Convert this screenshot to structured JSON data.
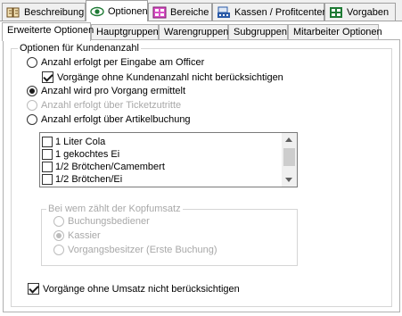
{
  "top_tabs": [
    {
      "label": "Beschreibung",
      "icon": "book-icon"
    },
    {
      "label": "Optionen",
      "icon": "eye-icon"
    },
    {
      "label": "Bereiche",
      "icon": "areas-icon"
    },
    {
      "label": "Kassen / Profitcenter",
      "icon": "register-icon"
    },
    {
      "label": "Vorgaben",
      "icon": "settings-grid-icon"
    }
  ],
  "sub_tabs": [
    {
      "label": "Erweiterte Optionen"
    },
    {
      "label": "Hauptgruppen"
    },
    {
      "label": "Warengruppen"
    },
    {
      "label": "Subgruppen"
    },
    {
      "label": "Mitarbeiter Optionen"
    }
  ],
  "group": {
    "title": "Optionen für Kundenanzahl",
    "opt_officer": "Anzahl erfolgt per Eingabe am Officer",
    "chk_ignore_no_customers": "Vorgänge ohne Kundenanzahl nicht berücksichtigen",
    "opt_per_vorgang": "Anzahl wird pro Vorgang ermittelt",
    "opt_ticket": "Anzahl erfolgt über Ticketzutritte",
    "opt_article": "Anzahl erfolgt über Artikelbuchung"
  },
  "articles": [
    "1 Liter Cola",
    "1 gekochtes Ei",
    "1/2 Brötchen/Camembert",
    "1/2 Brötchen/Ei"
  ],
  "kopfumsatz": {
    "title": "Bei wem zählt der Kopfumsatz",
    "options": [
      "Buchungsbediener",
      "Kassier",
      "Vorgangsbesitzer (Erste Buchung)"
    ],
    "selected_index": 1
  },
  "chk_ignore_no_sales": "Vorgänge ohne Umsatz nicht berücksichtigen",
  "colors": {
    "accent_green": "#1e7a34",
    "accent_purple": "#a0208f",
    "accent_blue": "#2a5aa8"
  }
}
